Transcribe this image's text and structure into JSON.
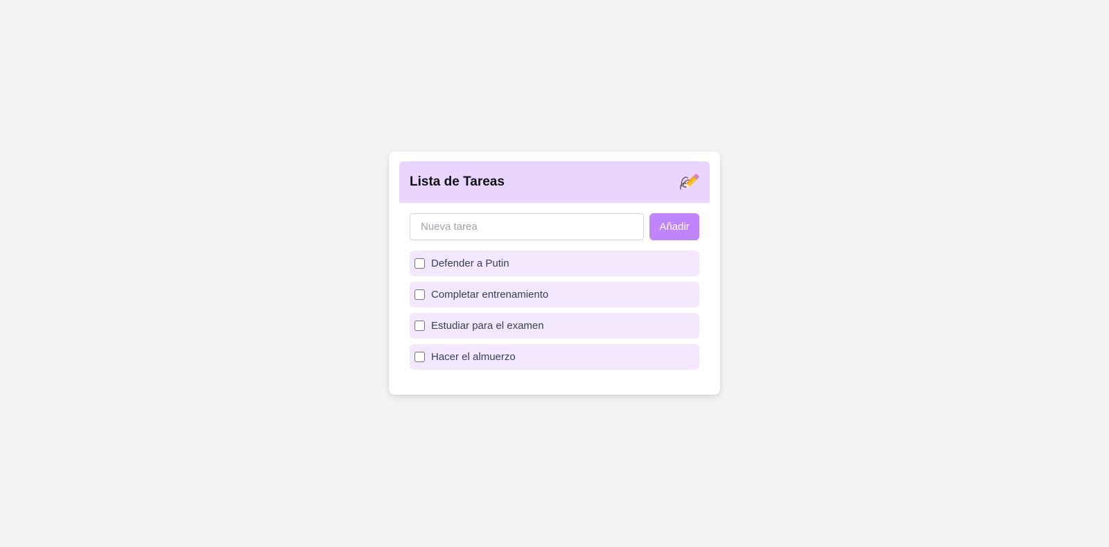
{
  "header": {
    "title": "Lista de Tareas",
    "icon": "memo-icon"
  },
  "form": {
    "input_value": "",
    "input_placeholder": "Nueva tarea",
    "add_label": "Añadir"
  },
  "tasks": [
    {
      "label": "Defender a Putin",
      "done": false
    },
    {
      "label": "Completar entrenamiento",
      "done": false
    },
    {
      "label": "Estudiar para el examen",
      "done": false
    },
    {
      "label": "Hacer el almuerzo",
      "done": false
    }
  ],
  "colors": {
    "background": "#f3f4f6",
    "header": "#e9d5ff",
    "accent": "#c084fc",
    "task_bg": "#f3e8ff"
  }
}
